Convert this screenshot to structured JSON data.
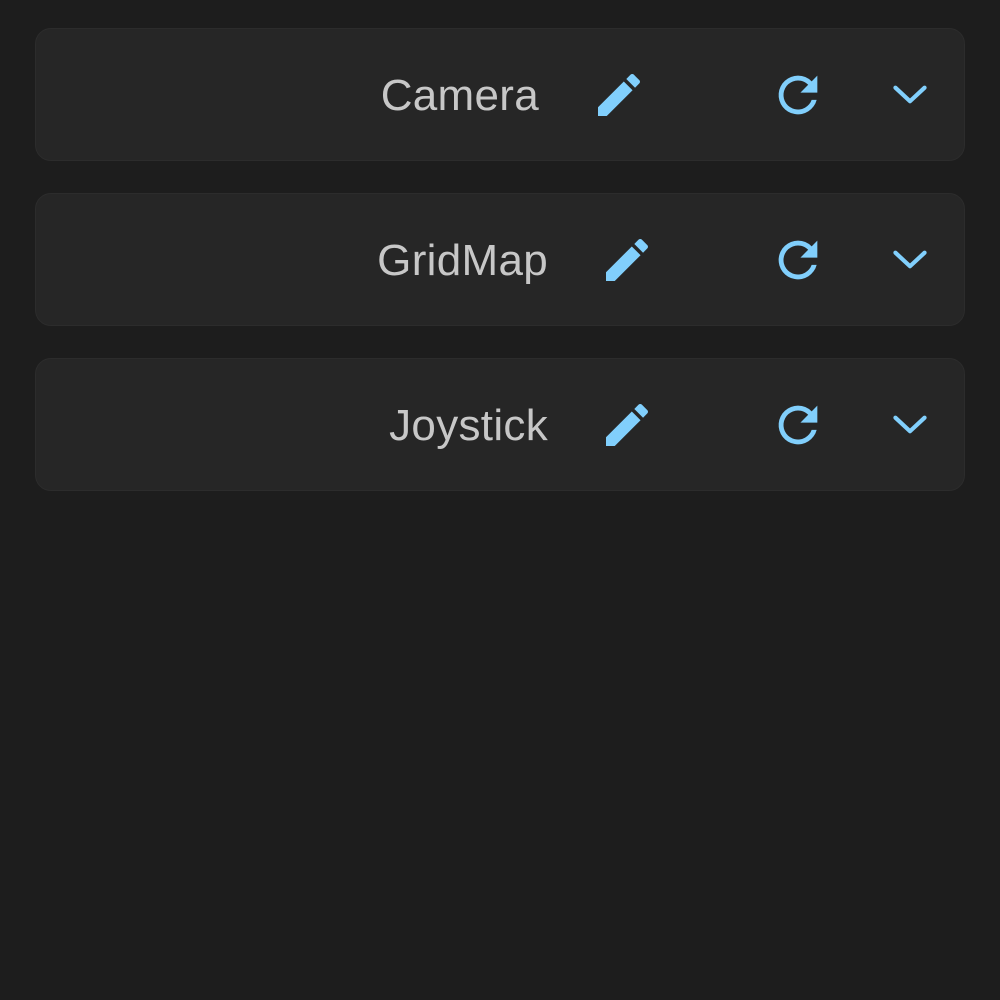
{
  "theme": {
    "background": "#1d1d1d",
    "panel_background": "#262626",
    "text_color": "#c7c7c7",
    "icon_accent": "#81cffc"
  },
  "panels": [
    {
      "name": "Camera",
      "icons": {
        "edit": "pencil-icon",
        "reset": "refresh-icon",
        "expand": "chevron-down-icon"
      }
    },
    {
      "name": "GridMap",
      "icons": {
        "edit": "pencil-icon",
        "reset": "refresh-icon",
        "expand": "chevron-down-icon"
      }
    },
    {
      "name": "Joystick",
      "icons": {
        "edit": "pencil-icon",
        "reset": "refresh-icon",
        "expand": "chevron-down-icon"
      }
    }
  ]
}
